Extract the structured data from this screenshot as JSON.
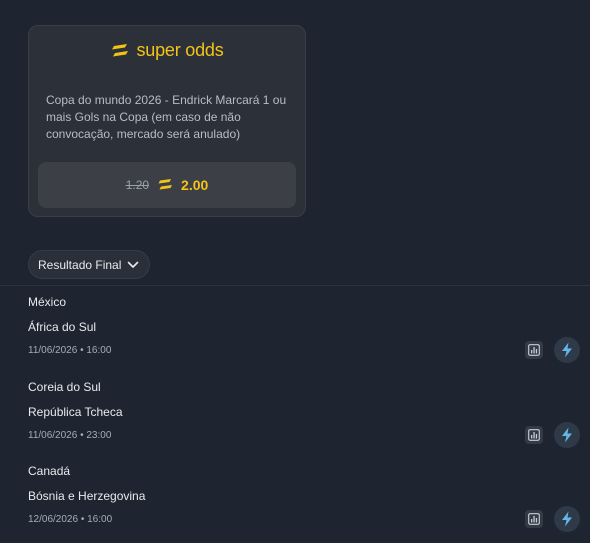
{
  "promo": {
    "brand": "super odds",
    "description": "Copa do mundo 2026 - Endrick Marcará 1 ou mais Gols na Copa (em caso de não convocação, mercado será anulado)",
    "old_odds": "1.20",
    "new_odds": "2.00",
    "accent_color": "#f2c418"
  },
  "filter": {
    "label": "Resultado Final",
    "icon": "chevron-down-icon"
  },
  "matches": [
    {
      "home": "México",
      "away": "África do Sul",
      "date": "11/06/2026",
      "time": "16:00"
    },
    {
      "home": "Coreia do Sul",
      "away": "República Tcheca",
      "date": "11/06/2026",
      "time": "23:00"
    },
    {
      "home": "Canadá",
      "away": "Bósnia e Herzegovina",
      "date": "12/06/2026",
      "time": "16:00"
    }
  ],
  "icons": {
    "stats": "bar-chart-icon",
    "quick_bet": "lightning-bolt-icon"
  },
  "colors": {
    "background": "#1e2530",
    "bolt": "#63b7e8"
  }
}
